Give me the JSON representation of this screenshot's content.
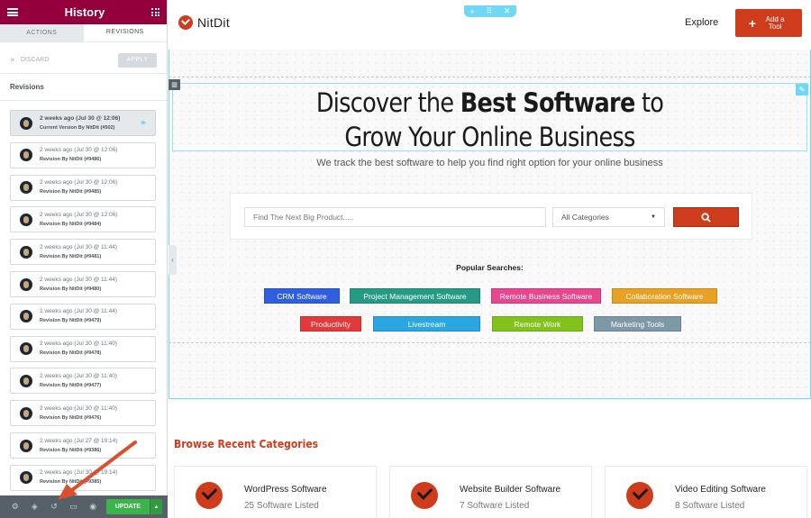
{
  "panel": {
    "title": "History",
    "tabs": [
      "ACTIONS",
      "REVISIONS"
    ],
    "discard_label": "DISCARD",
    "apply_label": "APPLY",
    "revisions_heading": "Revisions",
    "revisions": [
      {
        "time": "2 weeks ago (Jul 30 @ 12:06)",
        "desc": "Current Version By NitDit (#502)",
        "current": true
      },
      {
        "time": "2 weeks ago (Jul 30 @ 12:06)",
        "desc": "Revision By NitDit (#9486)"
      },
      {
        "time": "2 weeks ago (Jul 30 @ 12:06)",
        "desc": "Revision By NitDit (#9485)"
      },
      {
        "time": "2 weeks ago (Jul 30 @ 12:06)",
        "desc": "Revision By NitDit (#9484)"
      },
      {
        "time": "2 weeks ago (Jul 30 @ 11:44)",
        "desc": "Revision By NitDit (#9481)"
      },
      {
        "time": "2 weeks ago (Jul 30 @ 11:44)",
        "desc": "Revision By NitDit (#9480)"
      },
      {
        "time": "2 weeks ago (Jul 30 @ 11:44)",
        "desc": "Revision By NitDit (#9479)"
      },
      {
        "time": "2 weeks ago (Jul 30 @ 11:40)",
        "desc": "Revision By NitDit (#9478)"
      },
      {
        "time": "2 weeks ago (Jul 30 @ 11:40)",
        "desc": "Revision By NitDit (#9477)"
      },
      {
        "time": "2 weeks ago (Jul 30 @ 11:40)",
        "desc": "Revision By NitDit (#9476)"
      },
      {
        "time": "2 weeks ago (Jul 27 @ 19:14)",
        "desc": "Revision By NitDit (#9386)"
      },
      {
        "time": "2 weeks ago (Jul 30 @ 19:14)",
        "desc": "Revision By NitDit (#9385)"
      }
    ],
    "update_label": "UPDATE"
  },
  "site": {
    "logo_text": "NitDit",
    "nav_explore": "Explore",
    "add_tool_label": "Add a Tool",
    "headline_part1": "Discover the ",
    "headline_bold": "Best Software",
    "headline_part2": " to",
    "headline_line2": "Grow Your Online Business",
    "subline": "We track the best software to help you find right option for your online business",
    "search_placeholder": "Find The Next Big Product.....",
    "category_select": "All Categories",
    "popular_label": "Popular Searches:",
    "tags": [
      {
        "label": "CRM Software",
        "color": "#2f5fe0"
      },
      {
        "label": "Project Management Software",
        "color": "#259b85"
      },
      {
        "label": "Remote Business Software",
        "color": "#e8468e"
      },
      {
        "label": "Collaboration Software",
        "color": "#e9a124"
      },
      {
        "label": "Productivity",
        "color": "#e23a3a"
      },
      {
        "label": "Livestream",
        "color": "#2aa7e0"
      },
      {
        "label": "Remote Work",
        "color": "#82c21d"
      },
      {
        "label": "Marketing Tools",
        "color": "#7d98a6"
      }
    ],
    "browse_title": "Browse Recent Categories",
    "categories": [
      {
        "name": "WordPress Software",
        "count": "25 Software Listed"
      },
      {
        "name": "Website Builder Software",
        "count": "7 Software Listed"
      },
      {
        "name": "Video Editing Software",
        "count": "8 Software Listed"
      }
    ]
  },
  "colors": {
    "panel_header": "#93003c",
    "brand": "#cf3c1c",
    "editor_accent": "#71d7f7",
    "update_green": "#39b54a"
  }
}
